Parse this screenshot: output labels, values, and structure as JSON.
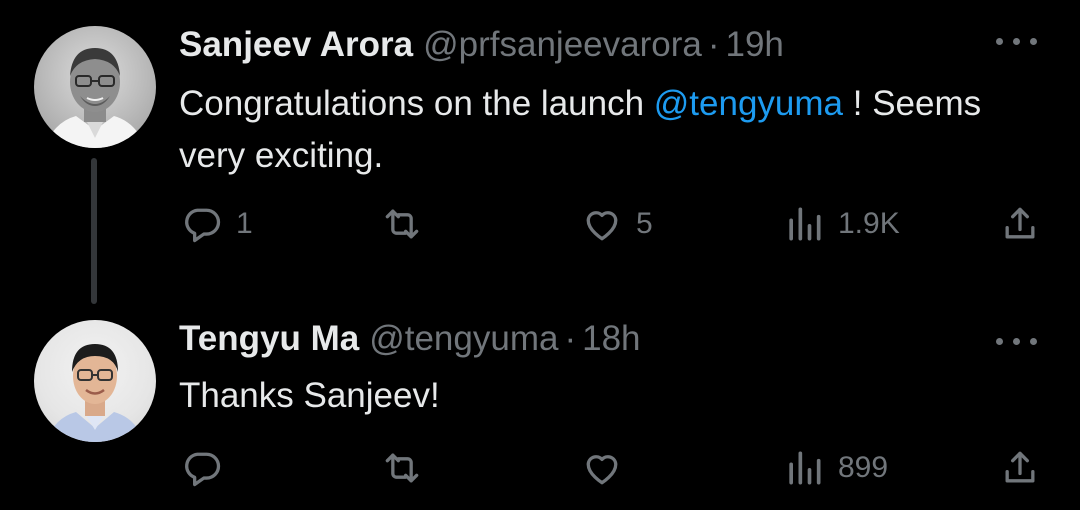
{
  "tweets": [
    {
      "author_name": "Sanjeev Arora",
      "handle": "@prfsanjeevarora",
      "separator": "·",
      "time": "19h",
      "text_before": "Congratulations on the launch ",
      "mention": "@tengyuma",
      "text_after": " ! Seems very exciting.",
      "reply_count": "1",
      "retweet_count": "",
      "like_count": "5",
      "view_count": "1.9K",
      "icons": [
        "more-horizontal-icon",
        "reply-icon",
        "retweet-icon",
        "like-icon",
        "views-icon",
        "share-icon"
      ]
    },
    {
      "author_name": "Tengyu Ma",
      "handle": "@tengyuma",
      "separator": "·",
      "time": "18h",
      "text": "Thanks Sanjeev!",
      "reply_count": "",
      "retweet_count": "",
      "like_count": "",
      "view_count": "899",
      "icons": [
        "more-horizontal-icon",
        "reply-icon",
        "retweet-icon",
        "like-icon",
        "views-icon",
        "share-icon"
      ]
    }
  ],
  "colors": {
    "background": "#000000",
    "text": "#e7e9ea",
    "muted": "#71767b",
    "link": "#1d9bf0",
    "thread_line": "#333639"
  }
}
